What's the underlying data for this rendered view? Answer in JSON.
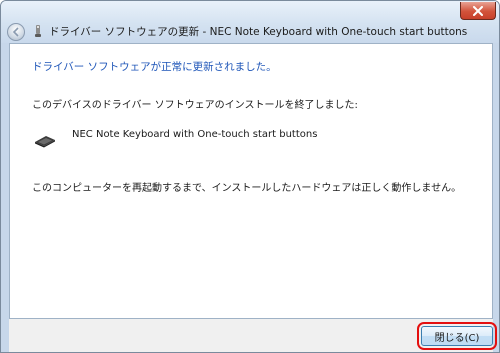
{
  "window": {
    "title": "ドライバー ソフトウェアの更新 - NEC Note Keyboard with One-touch start buttons"
  },
  "content": {
    "heading": "ドライバー ソフトウェアが正常に更新されました。",
    "description": "このデバイスのドライバー ソフトウェアのインストールを終了しました:",
    "device_name": "NEC Note Keyboard with One-touch start buttons",
    "note": "このコンピューターを再起動するまで、インストールしたハードウェアは正しく動作しません。"
  },
  "footer": {
    "close_label": "閉じる(C)"
  },
  "colors": {
    "heading": "#1f56b8",
    "highlight_outline": "#e40f0f"
  },
  "icons": {
    "back": "back-arrow-icon",
    "title": "device-driver-icon",
    "window_close": "close-icon",
    "device": "keyboard-icon"
  }
}
